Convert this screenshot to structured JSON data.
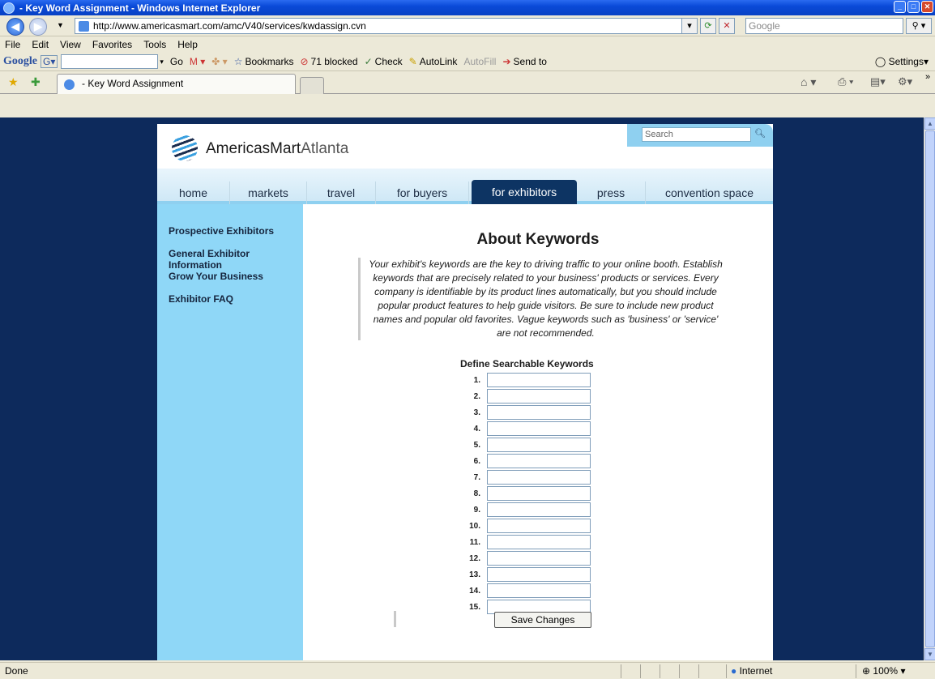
{
  "window": {
    "title": "- Key Word Assignment - Windows Internet Explorer"
  },
  "address": {
    "url": "http://www.americasmart.com/amc/V40/services/kwdassign.cvn",
    "search_placeholder": "Google"
  },
  "menu": {
    "items": [
      "File",
      "Edit",
      "View",
      "Favorites",
      "Tools",
      "Help"
    ]
  },
  "google_toolbar": {
    "logo": "Google",
    "go": "Go",
    "bookmarks": "Bookmarks",
    "blocked": "71 blocked",
    "check": "Check",
    "autolink": "AutoLink",
    "autofill": "AutoFill",
    "sendto": "Send to",
    "settings": "Settings"
  },
  "tabs": {
    "active_label": "- Key Word Assignment"
  },
  "site": {
    "logo": {
      "brand": "AmericasMart",
      "city": "Atlanta"
    },
    "search_placeholder": "Search",
    "nav": [
      "home",
      "markets",
      "travel",
      "for buyers",
      "for exhibitors",
      "press",
      "convention space"
    ],
    "active_nav": "for exhibitors",
    "sidebar": [
      "Prospective Exhibitors",
      "General Exhibitor Information",
      "Grow Your Business",
      "Exhibitor FAQ"
    ],
    "heading": "About Keywords",
    "intro": "Your exhibit's keywords are the key to driving traffic to your online booth. Establish keywords that are precisely related to your business' products or services. Every company is identifiable by its product lines automatically, but you should include popular product features to help guide visitors. Be sure to include new product names and popular old favorites. Vague keywords such as 'business' or 'service' are not recommended.",
    "form_title": "Define Searchable Keywords",
    "keyword_labels": [
      "1.",
      "2.",
      "3.",
      "4.",
      "5.",
      "6.",
      "7.",
      "8.",
      "9.",
      "10.",
      "11.",
      "12.",
      "13.",
      "14.",
      "15."
    ],
    "save_label": "Save Changes"
  },
  "status": {
    "text": "Done",
    "zone": "Internet",
    "zoom": "100%"
  }
}
